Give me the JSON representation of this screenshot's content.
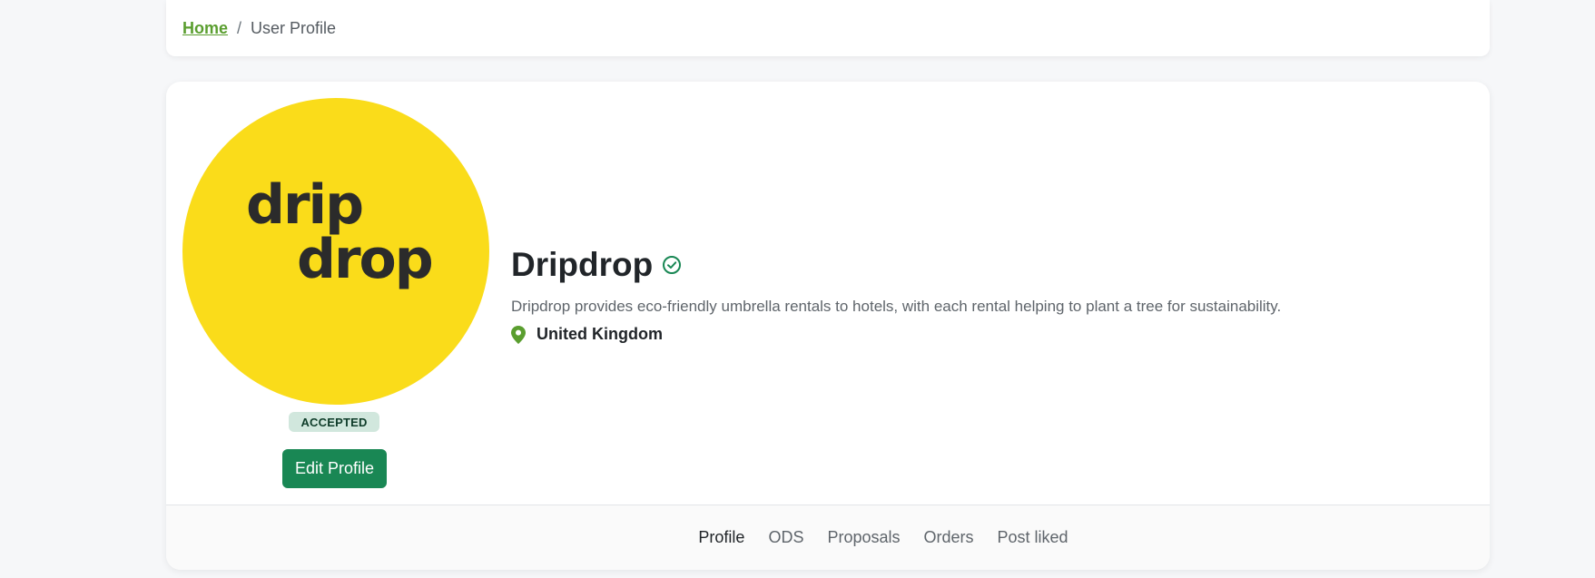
{
  "breadcrumb": {
    "home_label": "Home",
    "separator": "/",
    "current_label": "User Profile"
  },
  "profile": {
    "name": "Dripdrop",
    "description": "Dripdrop provides eco-friendly umbrella rentals to hotels, with each rental helping to plant a tree for sustainability.",
    "location": "United Kingdom",
    "status": "ACCEPTED",
    "edit_button_label": "Edit Profile",
    "avatar_logo_text_line1": "drip",
    "avatar_logo_text_line2": "drop",
    "verified_icon": "check-circle-icon",
    "location_icon": "map-pin-icon"
  },
  "tabs": [
    {
      "label": "Profile",
      "active": true
    },
    {
      "label": "ODS",
      "active": false
    },
    {
      "label": "Proposals",
      "active": false
    },
    {
      "label": "Orders",
      "active": false
    },
    {
      "label": "Post liked",
      "active": false
    }
  ],
  "colors": {
    "accent_green": "#198754",
    "link_green": "#5a9e2f",
    "avatar_yellow": "#fadc1a",
    "badge_bg": "#d1e7dd",
    "logo_dark": "#2b2b2b"
  }
}
